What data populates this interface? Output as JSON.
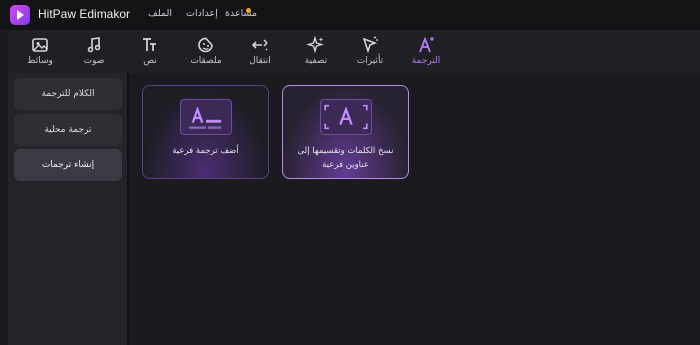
{
  "app": {
    "title": "HitPaw Edimakor"
  },
  "menu": {
    "file": "الملف",
    "settings": "إعدادات",
    "help": "مساعدة"
  },
  "toolbar": {
    "items": [
      {
        "label": "وسائط",
        "icon": "media-icon"
      },
      {
        "label": "صوت",
        "icon": "music-note-icon"
      },
      {
        "label": "نص",
        "icon": "text-icon"
      },
      {
        "label": "ملصقات",
        "icon": "sticker-icon"
      },
      {
        "label": "انتقال",
        "icon": "transition-icon"
      },
      {
        "label": "تصفية",
        "icon": "filter-sparkle-icon"
      },
      {
        "label": "تأثيرات",
        "icon": "effects-icon"
      },
      {
        "label": "الترجمة",
        "icon": "subtitle-icon"
      }
    ],
    "active": "الترجمة",
    "accent": "#b57cf7"
  },
  "sidebar": {
    "items": [
      {
        "label": "الكلام للترجمة"
      },
      {
        "label": "ترجمة محلية"
      },
      {
        "label": "إنشاء ترجمات"
      }
    ],
    "selected": "إنشاء ترجمات"
  },
  "cards": [
    {
      "caption": "أضف ترجمة فرعية",
      "icon": "add-subtitle-icon"
    },
    {
      "caption": "نسخ الكلمات وتقسيمها إلى عناوين فرعية",
      "icon": "auto-caption-icon"
    }
  ]
}
